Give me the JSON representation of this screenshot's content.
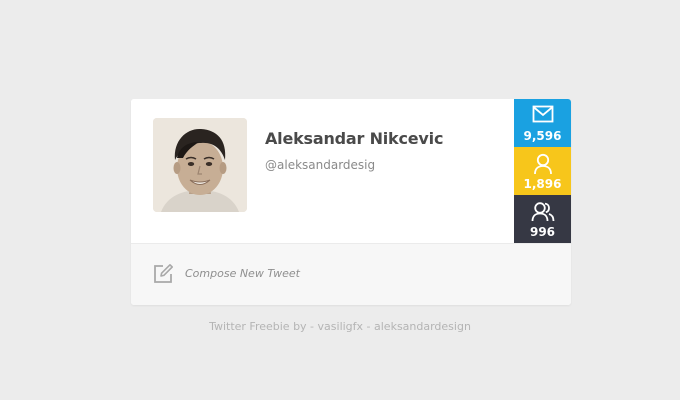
{
  "profile": {
    "name": "Aleksandar Nikcevic",
    "handle": "@aleksandardesig"
  },
  "stats": {
    "messages": {
      "count": "9,596",
      "icon": "envelope-icon",
      "color": "#1aa1e1"
    },
    "following": {
      "count": "1,896",
      "icon": "user-icon",
      "color": "#f7c61b"
    },
    "followers": {
      "count": "996",
      "icon": "users-icon",
      "color": "#363844"
    }
  },
  "compose": {
    "label": "Compose New Tweet",
    "icon": "edit-icon"
  },
  "footer": {
    "credit": "Twitter Freebie by - vasiligfx - aleksandardesign"
  }
}
